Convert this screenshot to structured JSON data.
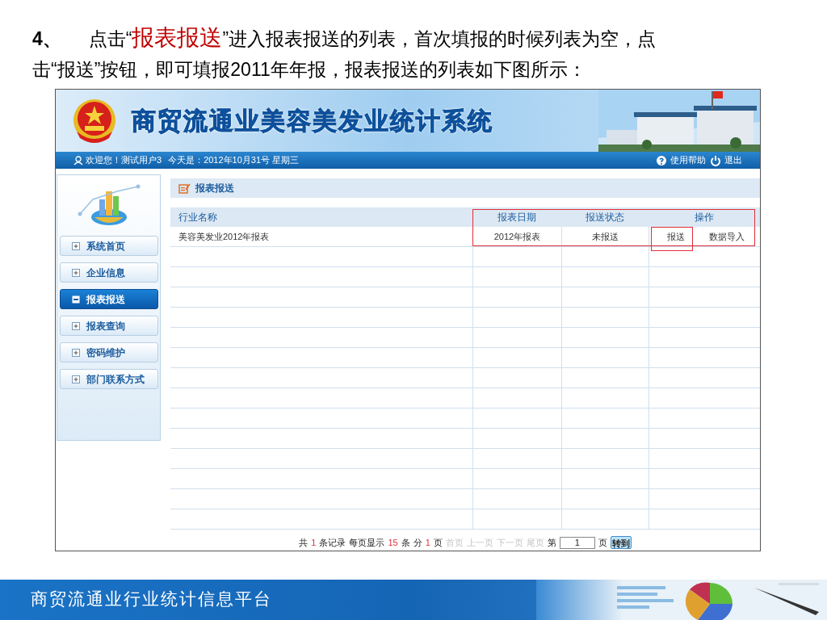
{
  "instruction": {
    "number": "4、",
    "text": "点击“**报表报送**”进入报表报送的列表，首次填报的时候列表为空，点击“报送”按钮，即可填报2011年年报，报表报送的列表如下图所示："
  },
  "app": {
    "title": "商贸流通业美容美发业统计系统",
    "user_bar": {
      "welcome": "欢迎您！测试用户3",
      "date": "今天是：2012年10月31号 星期三",
      "help": "使用帮助",
      "logout": "退出"
    },
    "sidebar": {
      "items": [
        {
          "label": "系统首页",
          "selected": false
        },
        {
          "label": "企业信息",
          "selected": false
        },
        {
          "label": "报表报送",
          "selected": true
        },
        {
          "label": "报表查询",
          "selected": false
        },
        {
          "label": "密码维护",
          "selected": false
        },
        {
          "label": "部门联系方式",
          "selected": false
        }
      ]
    },
    "section_title": "报表报送",
    "table": {
      "columns": [
        "行业名称",
        "报表日期",
        "报送状态",
        "操作"
      ],
      "rows": [
        {
          "cells": [
            "美容美发业2012年报表",
            "2012年报表",
            "未报送"
          ],
          "actions": [
            "报送",
            "数据导入"
          ]
        }
      ]
    },
    "pager": [
      {
        "kind": "text",
        "text": "共"
      },
      {
        "kind": "count",
        "text": "1"
      },
      {
        "kind": "text",
        "text": "条记录"
      },
      {
        "kind": "text",
        "text": "每页显示"
      },
      {
        "kind": "count",
        "text": "15"
      },
      {
        "kind": "text",
        "text": "条"
      },
      {
        "kind": "text",
        "text": "分"
      },
      {
        "kind": "count",
        "text": "1"
      },
      {
        "kind": "text",
        "text": "页"
      },
      {
        "kind": "link",
        "text": "首页",
        "disabled": true
      },
      {
        "kind": "link",
        "text": "上一页",
        "disabled": true
      },
      {
        "kind": "link",
        "text": "下一页",
        "disabled": true
      },
      {
        "kind": "link",
        "text": "尾页",
        "disabled": true
      },
      {
        "kind": "text",
        "text": "第"
      },
      {
        "kind": "input",
        "text": "1"
      },
      {
        "kind": "text",
        "text": "页"
      },
      {
        "kind": "button",
        "text": "转到"
      }
    ]
  },
  "footer": {
    "title": "商贸流通业行业统计信息平台"
  }
}
